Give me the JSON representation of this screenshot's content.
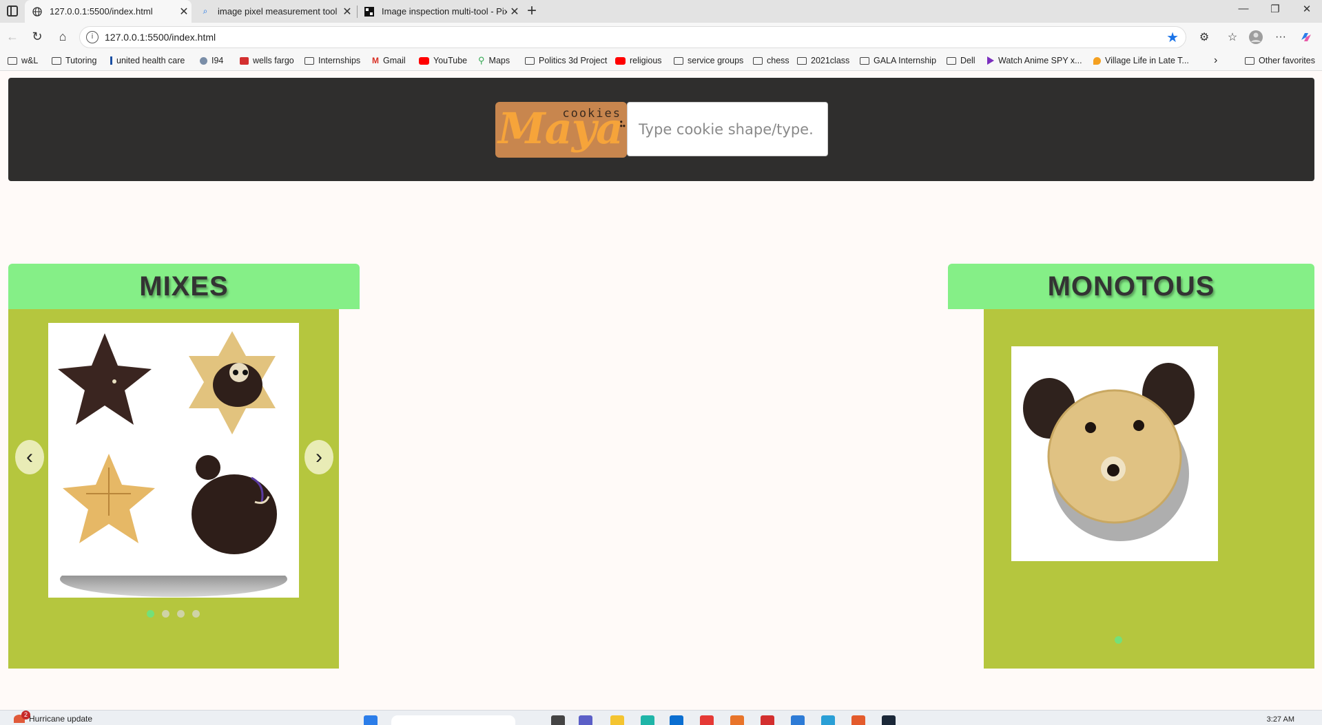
{
  "browser": {
    "tabs": [
      {
        "title": "127.0.0.1:5500/index.html",
        "active": true
      },
      {
        "title": "image pixel measurement tool - S",
        "active": false
      },
      {
        "title": "Image inspection multi-tool - Pix",
        "active": false
      }
    ],
    "url": "127.0.0.1:5500/index.html",
    "bookmarks": [
      {
        "label": "w&L",
        "icon": "folder"
      },
      {
        "label": "Tutoring",
        "icon": "folder"
      },
      {
        "label": "united health care",
        "icon": "blue"
      },
      {
        "label": "I94",
        "icon": "circ"
      },
      {
        "label": "wells fargo",
        "icon": "red"
      },
      {
        "label": "Internships",
        "icon": "folder"
      },
      {
        "label": "Gmail",
        "icon": "mail"
      },
      {
        "label": "YouTube",
        "icon": "yt"
      },
      {
        "label": "Maps",
        "icon": "pin"
      },
      {
        "label": "Politics 3d Project",
        "icon": "folder"
      },
      {
        "label": "religious",
        "icon": "yt"
      },
      {
        "label": "service groups",
        "icon": "folder"
      },
      {
        "label": "chess",
        "icon": "folder"
      },
      {
        "label": "2021class",
        "icon": "folder"
      },
      {
        "label": "GALA Internship",
        "icon": "folder"
      },
      {
        "label": "Dell",
        "icon": "folder"
      },
      {
        "label": "Watch Anime SPY x...",
        "icon": "purple"
      },
      {
        "label": "Village Life in Late T...",
        "icon": "orange"
      }
    ],
    "other_favorites": "Other favorites"
  },
  "header": {
    "logo_brand": "Maya",
    "logo_sub": "cookies",
    "search_placeholder": "Type cookie shape/type."
  },
  "sections": {
    "mixes": {
      "title": "MIXES",
      "prev": "‹",
      "next": "›",
      "slide_count": 4,
      "active_slide": 1
    },
    "monotous": {
      "title": "MONOTOUS",
      "slide_count": 1,
      "active_slide": 1
    }
  },
  "taskbar": {
    "weather_text": "Hurricane update",
    "weather_badge": "2",
    "time": "3:27 AM"
  },
  "colors": {
    "header_bg": "#2f2e2d",
    "section_title_bg": "#85ef87",
    "panel_bg": "#b5c63e",
    "dot_active": "#74e07a"
  }
}
